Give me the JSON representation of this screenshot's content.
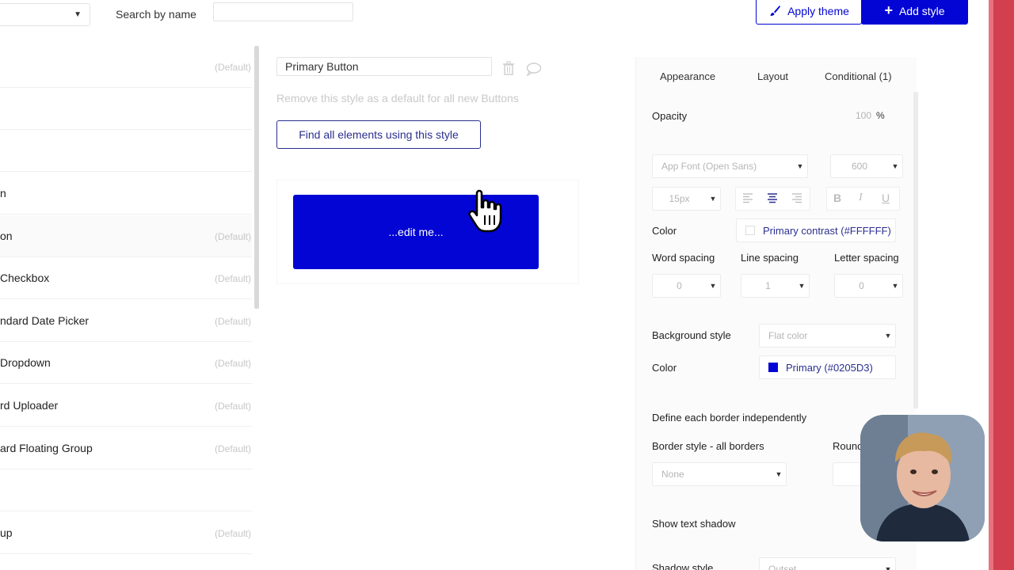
{
  "topbar": {
    "search_label": "Search by name",
    "search_placeholder": "",
    "apply_theme_label": "Apply theme",
    "add_style_label": "Add style"
  },
  "styles_list": [
    {
      "name": "",
      "default": "(Default)"
    },
    {
      "name": "",
      "default": ""
    },
    {
      "name": "",
      "default": ""
    },
    {
      "name": "n",
      "default": ""
    },
    {
      "name": "on",
      "default": "(Default)"
    },
    {
      "name": "Checkbox",
      "default": "(Default)"
    },
    {
      "name": "ndard Date Picker",
      "default": "(Default)"
    },
    {
      "name": "Dropdown",
      "default": "(Default)"
    },
    {
      "name": "rd Uploader",
      "default": "(Default)"
    },
    {
      "name": "ard Floating Group",
      "default": "(Default)"
    },
    {
      "name": "",
      "default": ""
    },
    {
      "name": "up",
      "default": "(Default)"
    }
  ],
  "editor": {
    "style_name": "Primary Button",
    "remove_default_text": "Remove this style as a default for all new Buttons",
    "find_elements_label": "Find all elements using this style",
    "preview_text": "...edit me..."
  },
  "panel": {
    "tabs": [
      "Appearance",
      "Layout",
      "Conditional (1)"
    ],
    "opacity_label": "Opacity",
    "opacity_value": "100",
    "opacity_unit": "%",
    "font_family": "App Font (Open Sans)",
    "font_weight": "600",
    "font_size": "15px",
    "format_letters": [
      "B",
      "I",
      "U"
    ],
    "color_label": "Color",
    "font_color": "Primary contrast (#FFFFFF)",
    "word_spacing_label": "Word spacing",
    "line_spacing_label": "Line spacing",
    "letter_spacing_label": "Letter spacing",
    "word_spacing": "0",
    "line_spacing": "1",
    "letter_spacing": "0",
    "background_style_label": "Background style",
    "background_style": "Flat color",
    "bg_color_label": "Color",
    "bg_color": "Primary (#0205D3)",
    "border_independent_label": "Define each border independently",
    "border_style_label": "Border style - all borders",
    "border_style": "None",
    "roundness_label": "Round",
    "text_shadow_label": "Show text shadow",
    "shadow_style_label": "Shadow style",
    "shadow_style": "Outset"
  },
  "colors": {
    "primary": "#0205D3",
    "primary_contrast": "#FFFFFF",
    "accent_edge": "#D23F4F"
  },
  "icons": [
    "caret-down-icon",
    "brush-icon",
    "plus-icon",
    "trash-icon",
    "comment-icon",
    "hand-cursor-icon",
    "align-left-icon",
    "align-center-icon",
    "align-right-icon"
  ]
}
